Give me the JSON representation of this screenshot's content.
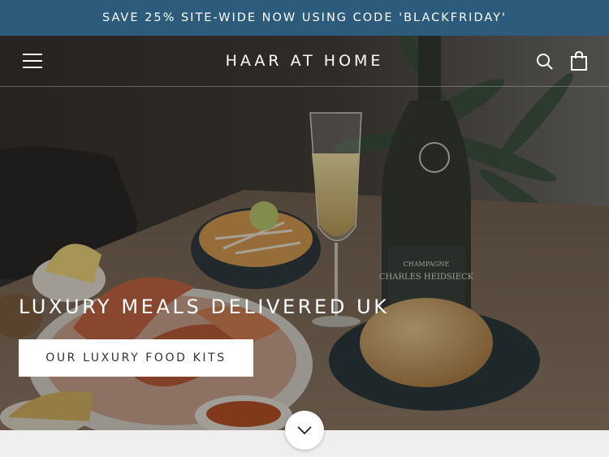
{
  "announcement": {
    "text": "SAVE 25% SITE-WIDE NOW USING CODE 'BLACKFRIDAY'"
  },
  "header": {
    "logo": "HAAR AT HOME"
  },
  "hero": {
    "headline": "LUXURY MEALS DELIVERED UK",
    "cta_label": "OUR LUXURY FOOD KITS",
    "bottle_label_brand": "CHARLES HEIDSIECK",
    "bottle_label_type": "CHAMPAGNE"
  },
  "icons": {
    "menu": "hamburger-menu-icon",
    "search": "search-icon",
    "cart": "shopping-bag-icon",
    "scroll": "chevron-down-icon"
  },
  "colors": {
    "announcement_bg": "#2c5b7c",
    "hero_overlay": "#1c1a18",
    "cta_bg": "#ffffff"
  }
}
